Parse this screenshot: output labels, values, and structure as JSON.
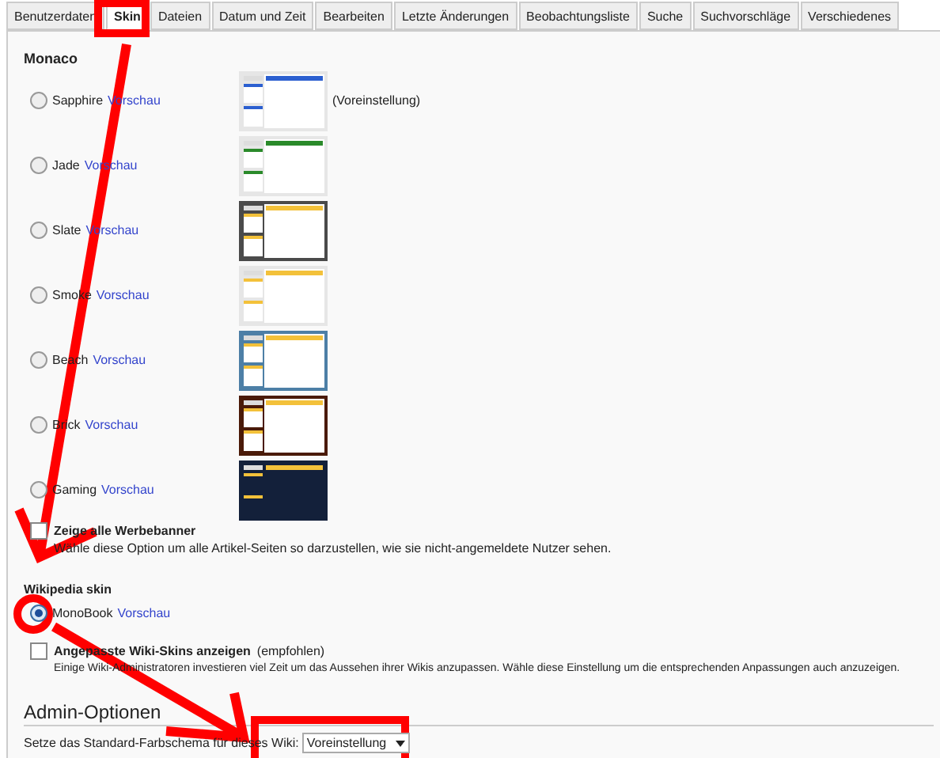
{
  "tabs": [
    {
      "label": "Benutzerdaten",
      "selected": false
    },
    {
      "label": "Skin",
      "selected": true
    },
    {
      "label": "Dateien",
      "selected": false
    },
    {
      "label": "Datum und Zeit",
      "selected": false
    },
    {
      "label": "Bearbeiten",
      "selected": false
    },
    {
      "label": "Letzte Änderungen",
      "selected": false
    },
    {
      "label": "Beobachtungsliste",
      "selected": false
    },
    {
      "label": "Suche",
      "selected": false
    },
    {
      "label": "Suchvorschläge",
      "selected": false
    },
    {
      "label": "Verschiedenes",
      "selected": false
    }
  ],
  "monaco": {
    "heading": "Monaco",
    "skins": [
      {
        "name": "Sapphire",
        "link": "Vorschau",
        "selected": false,
        "kind": "plain",
        "color": "#2b5fd0",
        "note": "(Voreinstellung)"
      },
      {
        "name": "Jade",
        "link": "Vorschau",
        "selected": false,
        "kind": "plain",
        "color": "#2a8a2a"
      },
      {
        "name": "Slate",
        "link": "Vorschau",
        "selected": false,
        "kind": "framed",
        "color": "#4a4a4a"
      },
      {
        "name": "Smoke",
        "link": "Vorschau",
        "selected": false,
        "kind": "plain",
        "color": "#f3c13a"
      },
      {
        "name": "Beach",
        "link": "Vorschau",
        "selected": false,
        "kind": "framed",
        "color": "#4d7fa6"
      },
      {
        "name": "Brick",
        "link": "Vorschau",
        "selected": false,
        "kind": "framed",
        "color": "#4a1a08"
      },
      {
        "name": "Gaming",
        "link": "Vorschau",
        "selected": false,
        "kind": "dark",
        "color": "#13203a"
      }
    ],
    "show_ads": {
      "label": "Zeige alle Werbebanner",
      "description": "Wähle diese Option um alle Artikel-Seiten so darzustellen, wie sie nicht-angemeldete Nutzer sehen.",
      "checked": false
    }
  },
  "wikipedia": {
    "heading": "Wikipedia skin",
    "option": {
      "name": "MonoBook",
      "link": "Vorschau",
      "selected": true
    },
    "custom": {
      "label": "Angepasste Wiki-Skins anzeigen",
      "note": "(empfohlen)",
      "description": "Einige Wiki-Administratoren investieren viel Zeit um das Aussehen ihrer Wikis anzupassen. Wähle diese Einstellung um die entsprechenden Anpassungen auch anzuzeigen.",
      "checked": false
    }
  },
  "admin": {
    "heading": "Admin-Optionen",
    "label": "Setze das Standard-Farbschema für dieses Wiki:",
    "select": {
      "value": "Voreinstellung"
    }
  }
}
